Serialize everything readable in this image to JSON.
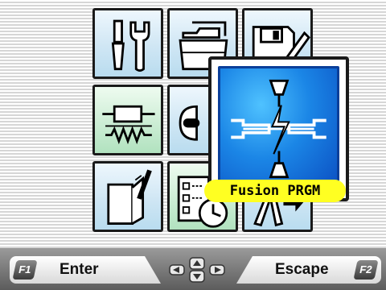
{
  "menu": {
    "items": [
      {
        "id": "maintenance",
        "icon": "wrench-screwdriver-icon",
        "color": "blue"
      },
      {
        "id": "file",
        "icon": "folder-icon",
        "color": "blue"
      },
      {
        "id": "save",
        "icon": "floppy-pencil-icon",
        "color": "blue"
      },
      {
        "id": "heater",
        "icon": "heater-resistor-icon",
        "color": "green"
      },
      {
        "id": "splice",
        "icon": "fiber-connector-icon",
        "color": "blue"
      },
      {
        "id": "fusion-program",
        "icon": "fusion-arc-icon",
        "color": "blue"
      },
      {
        "id": "notes",
        "icon": "notepad-pen-icon",
        "color": "blue"
      },
      {
        "id": "checklist",
        "icon": "checklist-clock-icon",
        "color": "green"
      },
      {
        "id": "tools",
        "icon": "cleaver-tool-icon",
        "color": "blue"
      }
    ],
    "selected_label": "Fusion PRGM",
    "selected_color": "#ffff22"
  },
  "footer": {
    "enter_key": "F1",
    "enter_label": "Enter",
    "escape_key": "F2",
    "escape_label": "Escape",
    "nav_icon": "arrow-keys-icon"
  }
}
